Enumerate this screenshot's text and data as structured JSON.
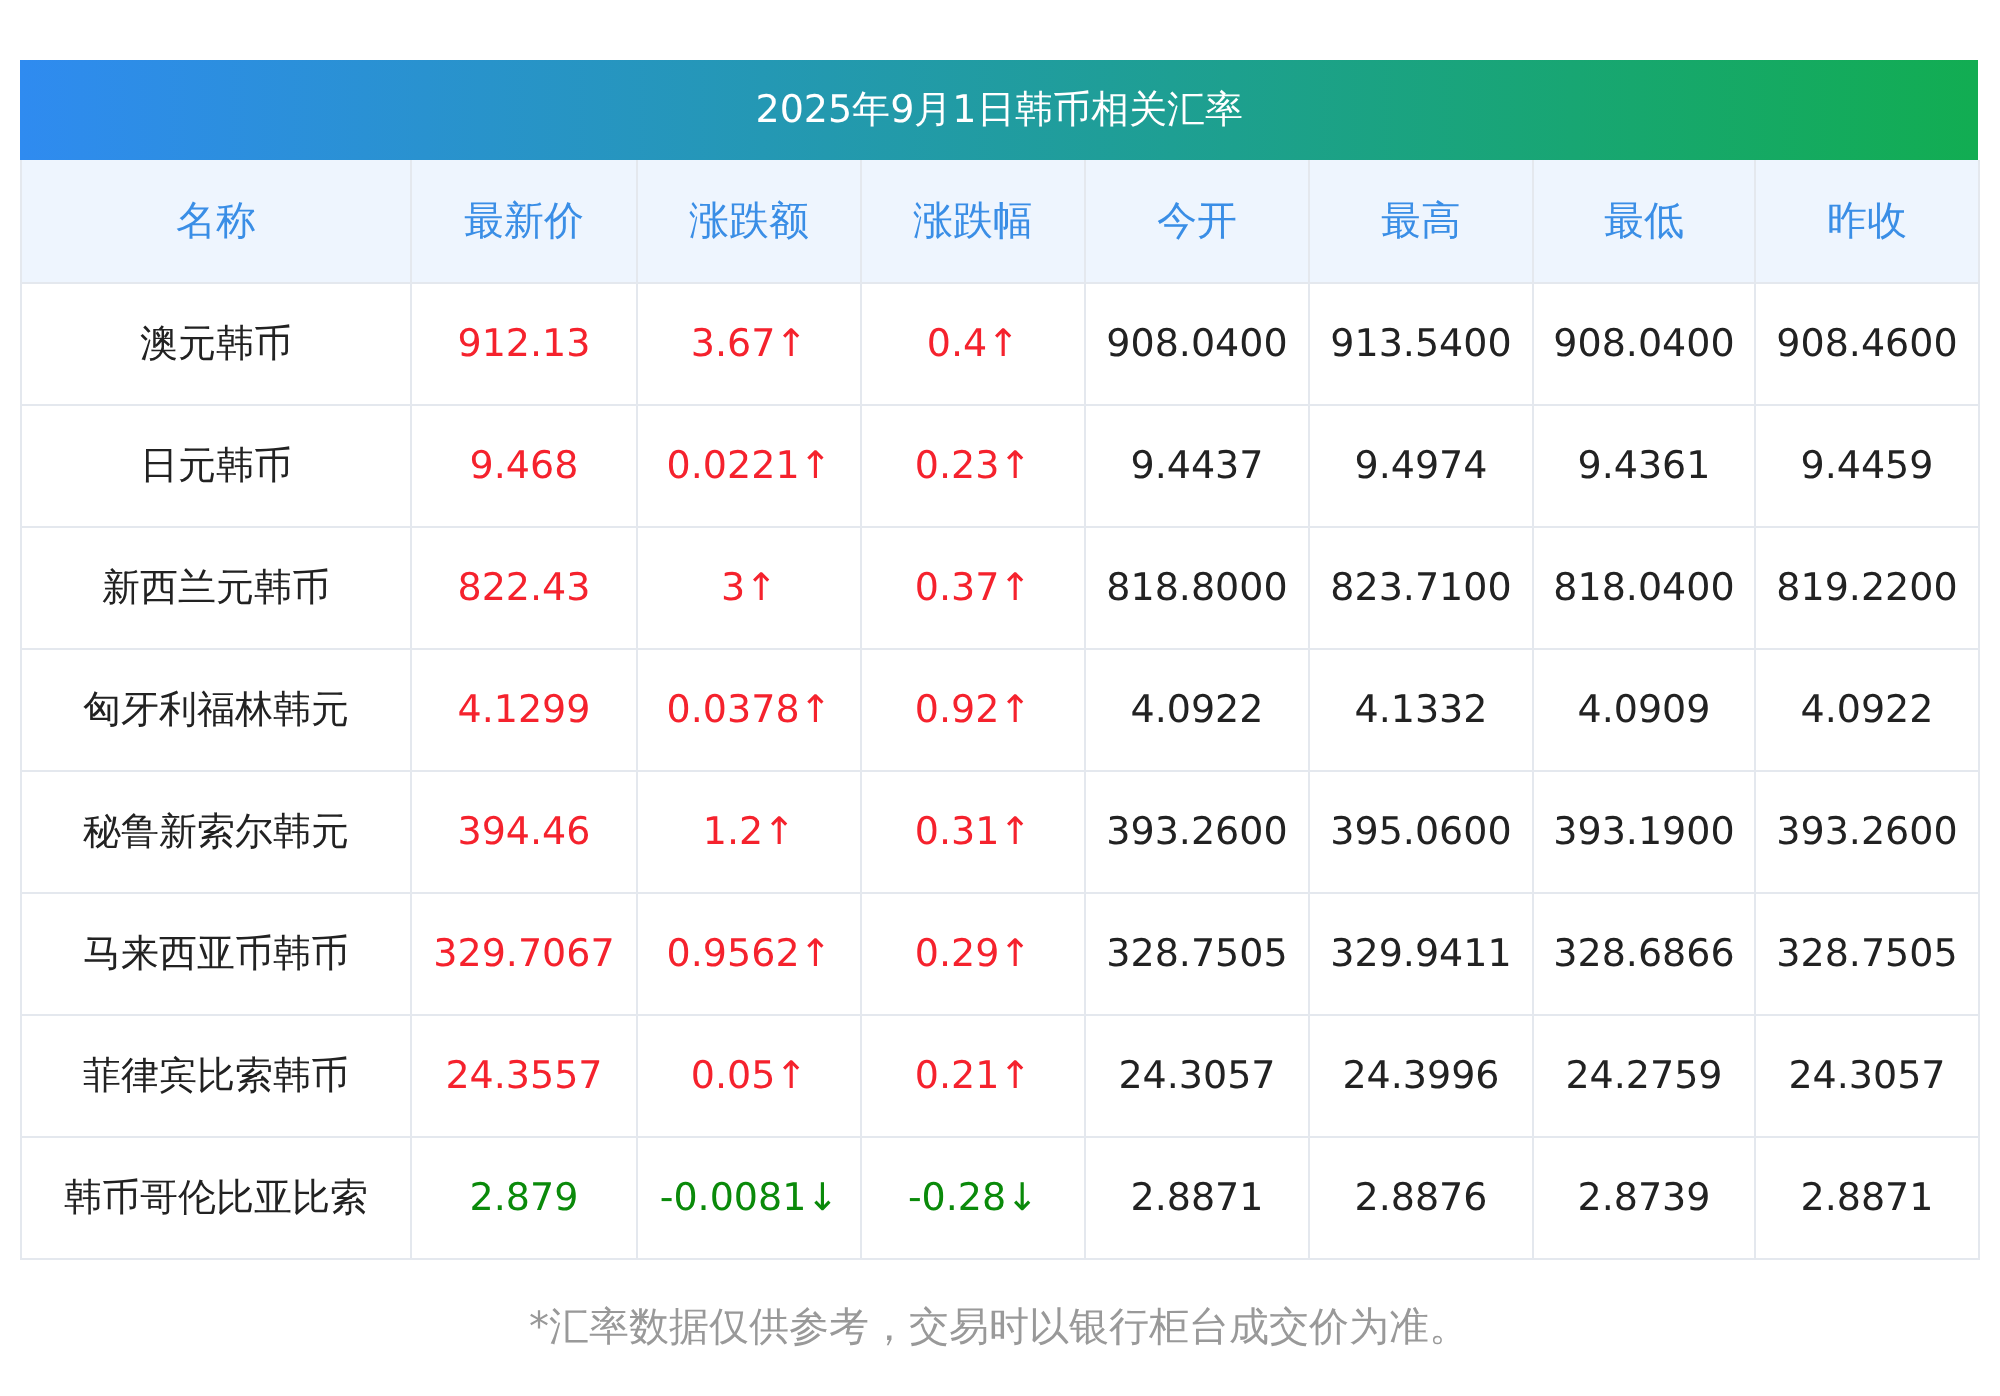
{
  "title": "2025年9月1日韩币相关汇率",
  "columns": [
    "名称",
    "最新价",
    "涨跌额",
    "涨跌幅",
    "今开",
    "最高",
    "最低",
    "昨收"
  ],
  "rows": [
    {
      "rising": true,
      "cells": [
        "澳元韩币",
        "912.13",
        "3.67↑",
        "0.4↑",
        "908.0400",
        "913.5400",
        "908.0400",
        "908.4600"
      ]
    },
    {
      "rising": true,
      "cells": [
        "日元韩币",
        "9.468",
        "0.0221↑",
        "0.23↑",
        "9.4437",
        "9.4974",
        "9.4361",
        "9.4459"
      ]
    },
    {
      "rising": true,
      "cells": [
        "新西兰元韩币",
        "822.43",
        "3↑",
        "0.37↑",
        "818.8000",
        "823.7100",
        "818.0400",
        "819.2200"
      ]
    },
    {
      "rising": true,
      "cells": [
        "匈牙利福林韩元",
        "4.1299",
        "0.0378↑",
        "0.92↑",
        "4.0922",
        "4.1332",
        "4.0909",
        "4.0922"
      ]
    },
    {
      "rising": true,
      "cells": [
        "秘鲁新索尔韩元",
        "394.46",
        "1.2↑",
        "0.31↑",
        "393.2600",
        "395.0600",
        "393.1900",
        "393.2600"
      ]
    },
    {
      "rising": true,
      "cells": [
        "马来西亚币韩币",
        "329.7067",
        "0.9562↑",
        "0.29↑",
        "328.7505",
        "329.9411",
        "328.6866",
        "328.7505"
      ]
    },
    {
      "rising": true,
      "cells": [
        "菲律宾比索韩币",
        "24.3557",
        "0.05↑",
        "0.21↑",
        "24.3057",
        "24.3996",
        "24.2759",
        "24.3057"
      ]
    },
    {
      "rising": false,
      "cells": [
        "韩币哥伦比亚比索",
        "2.879",
        "-0.0081↓",
        "-0.28↓",
        "2.8871",
        "2.8876",
        "2.8739",
        "2.8871"
      ]
    }
  ],
  "footnote": "*汇率数据仅供参考，交易时以银行柜台成交价为准。"
}
